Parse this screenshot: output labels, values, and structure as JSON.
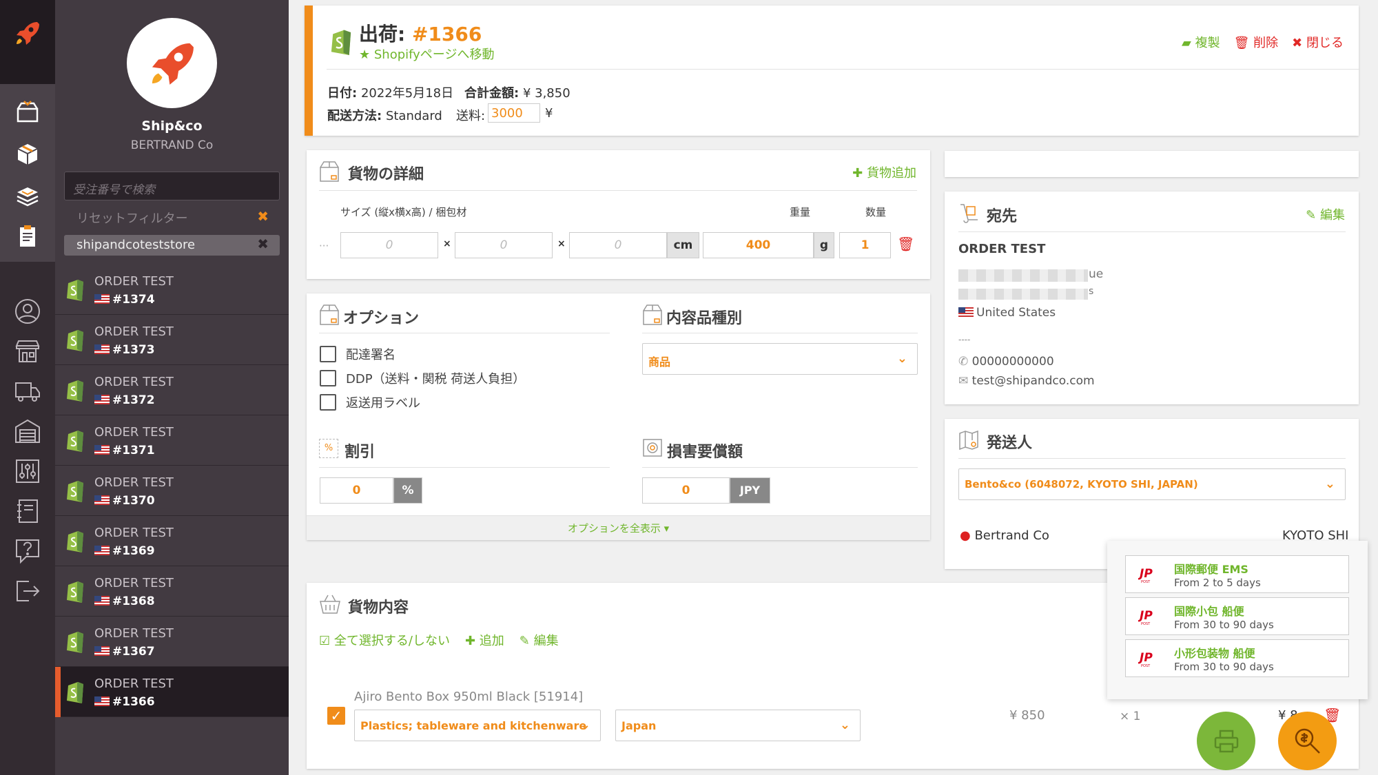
{
  "app": {
    "name": "Ship&co",
    "company": "BERTRAND Co"
  },
  "sidebar": {
    "search_placeholder": "受注番号で検索",
    "reset_filter": "リセットフィルター",
    "active_filter": "shipandcoteststore",
    "orders": [
      {
        "name": "ORDER TEST",
        "number": "#1374",
        "selected": false
      },
      {
        "name": "ORDER TEST",
        "number": "#1373",
        "selected": false
      },
      {
        "name": "ORDER TEST",
        "number": "#1372",
        "selected": false
      },
      {
        "name": "ORDER TEST",
        "number": "#1371",
        "selected": false
      },
      {
        "name": "ORDER TEST",
        "number": "#1370",
        "selected": false
      },
      {
        "name": "ORDER TEST",
        "number": "#1369",
        "selected": false
      },
      {
        "name": "ORDER TEST",
        "number": "#1368",
        "selected": false
      },
      {
        "name": "ORDER TEST",
        "number": "#1367",
        "selected": false
      },
      {
        "name": "ORDER TEST",
        "number": "#1366",
        "selected": true
      }
    ]
  },
  "header": {
    "title_prefix": "出荷:",
    "order_number": "#1366",
    "shopify_link": "★ Shopifyページへ移動",
    "actions": {
      "duplicate": "複製",
      "delete": "削除",
      "close": "閉じる"
    },
    "date_label": "日付:",
    "date_value": "2022年5月18日",
    "total_label": "合計金額:",
    "total_value": "¥ 3,850",
    "method_label": "配送方法:",
    "method_value": "Standard",
    "fee_label": "送料:",
    "fee_value": "3000",
    "fee_currency": "¥"
  },
  "package": {
    "title": "貨物の詳細",
    "add": "貨物追加",
    "size_label": "サイズ (縦x横x高) / 梱包材",
    "weight_label": "重量",
    "qty_label": "数量",
    "dim_placeholder": "0",
    "dims_sep": "×",
    "dim_unit": "cm",
    "weight": "400",
    "weight_unit": "g",
    "qty": "1",
    "more": "···"
  },
  "options": {
    "title": "オプション",
    "items": [
      "配達署名",
      "DDP（送料・関税 荷送人負担）",
      "返送用ラベル"
    ],
    "content_type_title": "内容品種別",
    "content_type": "商品",
    "discount_title": "割引",
    "discount_value": "0",
    "discount_unit": "%",
    "insurance_title": "損害要償額",
    "insurance_value": "0",
    "insurance_unit": "JPY",
    "show_all": "オプションを全表示 ▾",
    "discount_icon_text": "%"
  },
  "recipient": {
    "title": "宛先",
    "edit": "編集",
    "name": "ORDER TEST",
    "addr1_tail": "ue",
    "addr2_tail": "s",
    "country": "United States",
    "dashes": "----",
    "phone": "00000000000",
    "email": "test@shipandco.com"
  },
  "sender": {
    "title": "発送人",
    "select": "Bento&co (6048072, KYOTO SHI, JAPAN)",
    "name": "Bertrand Co",
    "city": "KYOTO SHI"
  },
  "carriers": [
    {
      "name": "国際郵便 EMS",
      "detail": "From 2 to 5 days"
    },
    {
      "name": "国際小包 船便",
      "detail": "From 30 to 90 days"
    },
    {
      "name": "小形包装物 船便",
      "detail": "From 30 to 90 days"
    }
  ],
  "contents": {
    "title": "貨物内容",
    "select_all": "全て選択する/しない",
    "add": "追加",
    "edit": "編集",
    "item": {
      "title": "Ajiro Bento Box 950ml Black [51914]",
      "category": "Plastics; tableware and kitchenware",
      "origin": "Japan",
      "price": "¥ 850",
      "qty": "× 1",
      "total": "¥ 8"
    }
  },
  "colors": {
    "accent": "#f08c1a",
    "green": "#70b62c",
    "red": "#e12826",
    "sidebar": "#423a41"
  }
}
